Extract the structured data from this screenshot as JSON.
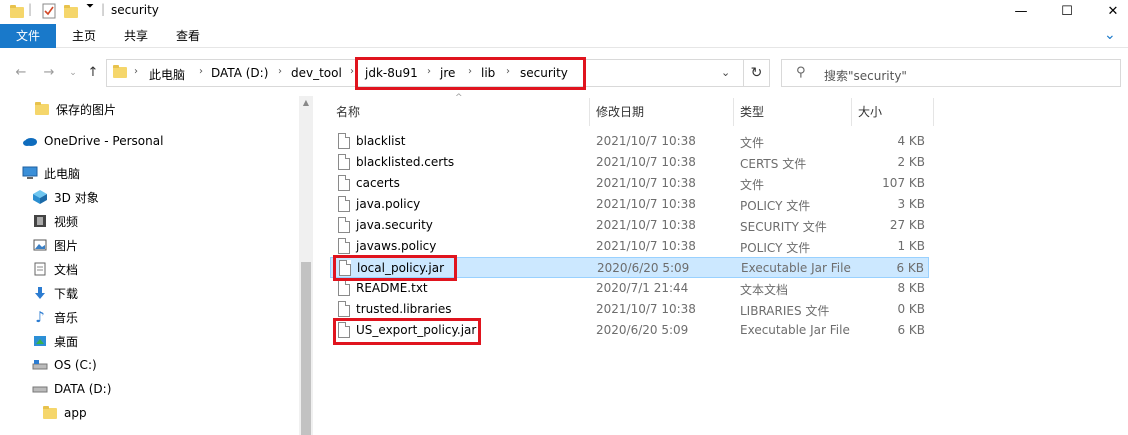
{
  "window": {
    "title": "security",
    "controls": {
      "minimize": "—",
      "maximize": "☐",
      "close": "✕"
    }
  },
  "ribbon": {
    "tabs": [
      "文件",
      "主页",
      "共享",
      "查看"
    ]
  },
  "address": {
    "breadcrumbs": [
      "此电脑",
      "DATA (D:)",
      "dev_tool",
      "jdk-8u91",
      "jre",
      "lib",
      "security"
    ],
    "search_placeholder": "搜索\"security\""
  },
  "sidebar": {
    "items": [
      {
        "label": "保存的图片",
        "icon": "folder-icon"
      },
      {
        "label": "OneDrive - Personal",
        "icon": "cloud-icon"
      },
      {
        "label": "此电脑",
        "icon": "computer-icon"
      },
      {
        "label": "3D 对象",
        "icon": "3d-objects-icon"
      },
      {
        "label": "视频",
        "icon": "video-icon"
      },
      {
        "label": "图片",
        "icon": "pictures-icon"
      },
      {
        "label": "文档",
        "icon": "documents-icon"
      },
      {
        "label": "下载",
        "icon": "download-icon"
      },
      {
        "label": "音乐",
        "icon": "music-icon"
      },
      {
        "label": "桌面",
        "icon": "desktop-icon"
      },
      {
        "label": "OS (C:)",
        "icon": "drive-c-icon"
      },
      {
        "label": "DATA (D:)",
        "icon": "drive-icon"
      },
      {
        "label": "app",
        "icon": "folder-icon"
      }
    ]
  },
  "columns": {
    "name": "名称",
    "date": "修改日期",
    "type": "类型",
    "size": "大小"
  },
  "files": [
    {
      "name": "blacklist",
      "date": "2021/10/7 10:38",
      "type": "文件",
      "size": "4 KB"
    },
    {
      "name": "blacklisted.certs",
      "date": "2021/10/7 10:38",
      "type": "CERTS 文件",
      "size": "2 KB"
    },
    {
      "name": "cacerts",
      "date": "2021/10/7 10:38",
      "type": "文件",
      "size": "107 KB"
    },
    {
      "name": "java.policy",
      "date": "2021/10/7 10:38",
      "type": "POLICY 文件",
      "size": "3 KB"
    },
    {
      "name": "java.security",
      "date": "2021/10/7 10:38",
      "type": "SECURITY 文件",
      "size": "27 KB"
    },
    {
      "name": "javaws.policy",
      "date": "2021/10/7 10:38",
      "type": "POLICY 文件",
      "size": "1 KB"
    },
    {
      "name": "local_policy.jar",
      "date": "2020/6/20 5:09",
      "type": "Executable Jar File",
      "size": "6 KB"
    },
    {
      "name": "README.txt",
      "date": "2020/7/1 21:44",
      "type": "文本文档",
      "size": "8 KB"
    },
    {
      "name": "trusted.libraries",
      "date": "2021/10/7 10:38",
      "type": "LIBRARIES 文件",
      "size": "0 KB"
    },
    {
      "name": "US_export_policy.jar",
      "date": "2020/6/20 5:09",
      "type": "Executable Jar File",
      "size": "6 KB"
    }
  ],
  "colors": {
    "accent": "#1979ca",
    "selection": "#cce8ff",
    "highlight": "#e0141e"
  }
}
